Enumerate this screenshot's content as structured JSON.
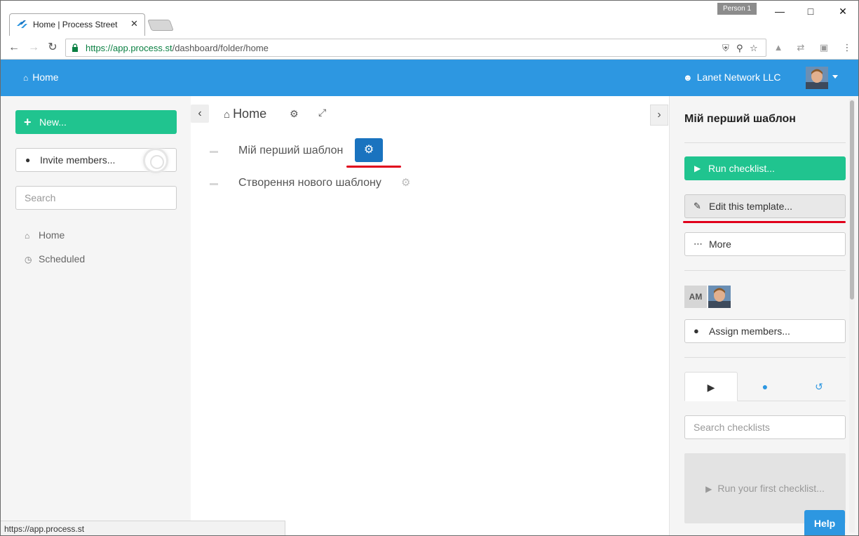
{
  "browser": {
    "tab_title": "Home | Process Street",
    "tab_close": "✕",
    "profile": "Person 1",
    "url_host": "https://app.process.st",
    "url_path": "/dashboard/folder/home",
    "status_url": "https://app.process.st"
  },
  "header": {
    "home_label": "Home",
    "org_name": "Lanet Network LLC"
  },
  "sidebar": {
    "new_label": "New...",
    "invite_label": "Invite members...",
    "search_placeholder": "Search",
    "nav": [
      {
        "label": "Home",
        "icon": "home-icon"
      },
      {
        "label": "Scheduled",
        "icon": "clock-icon"
      }
    ]
  },
  "main": {
    "breadcrumb": "Home",
    "templates": [
      {
        "name": "Мій перший шаблон",
        "selected": true
      },
      {
        "name": "Створення нового шаблону",
        "selected": false
      }
    ]
  },
  "panel": {
    "title": "Мій перший шаблон",
    "run_label": "Run checklist...",
    "edit_label": "Edit this template...",
    "more_label": "More",
    "member_initials": "AM",
    "assign_label": "Assign members...",
    "search_placeholder": "Search checklists",
    "empty_label": "Run your first checklist...",
    "help_label": "Help"
  },
  "colors": {
    "brand_blue": "#2d97e1",
    "green": "#20c48f",
    "annotation_red": "#e0001b"
  }
}
